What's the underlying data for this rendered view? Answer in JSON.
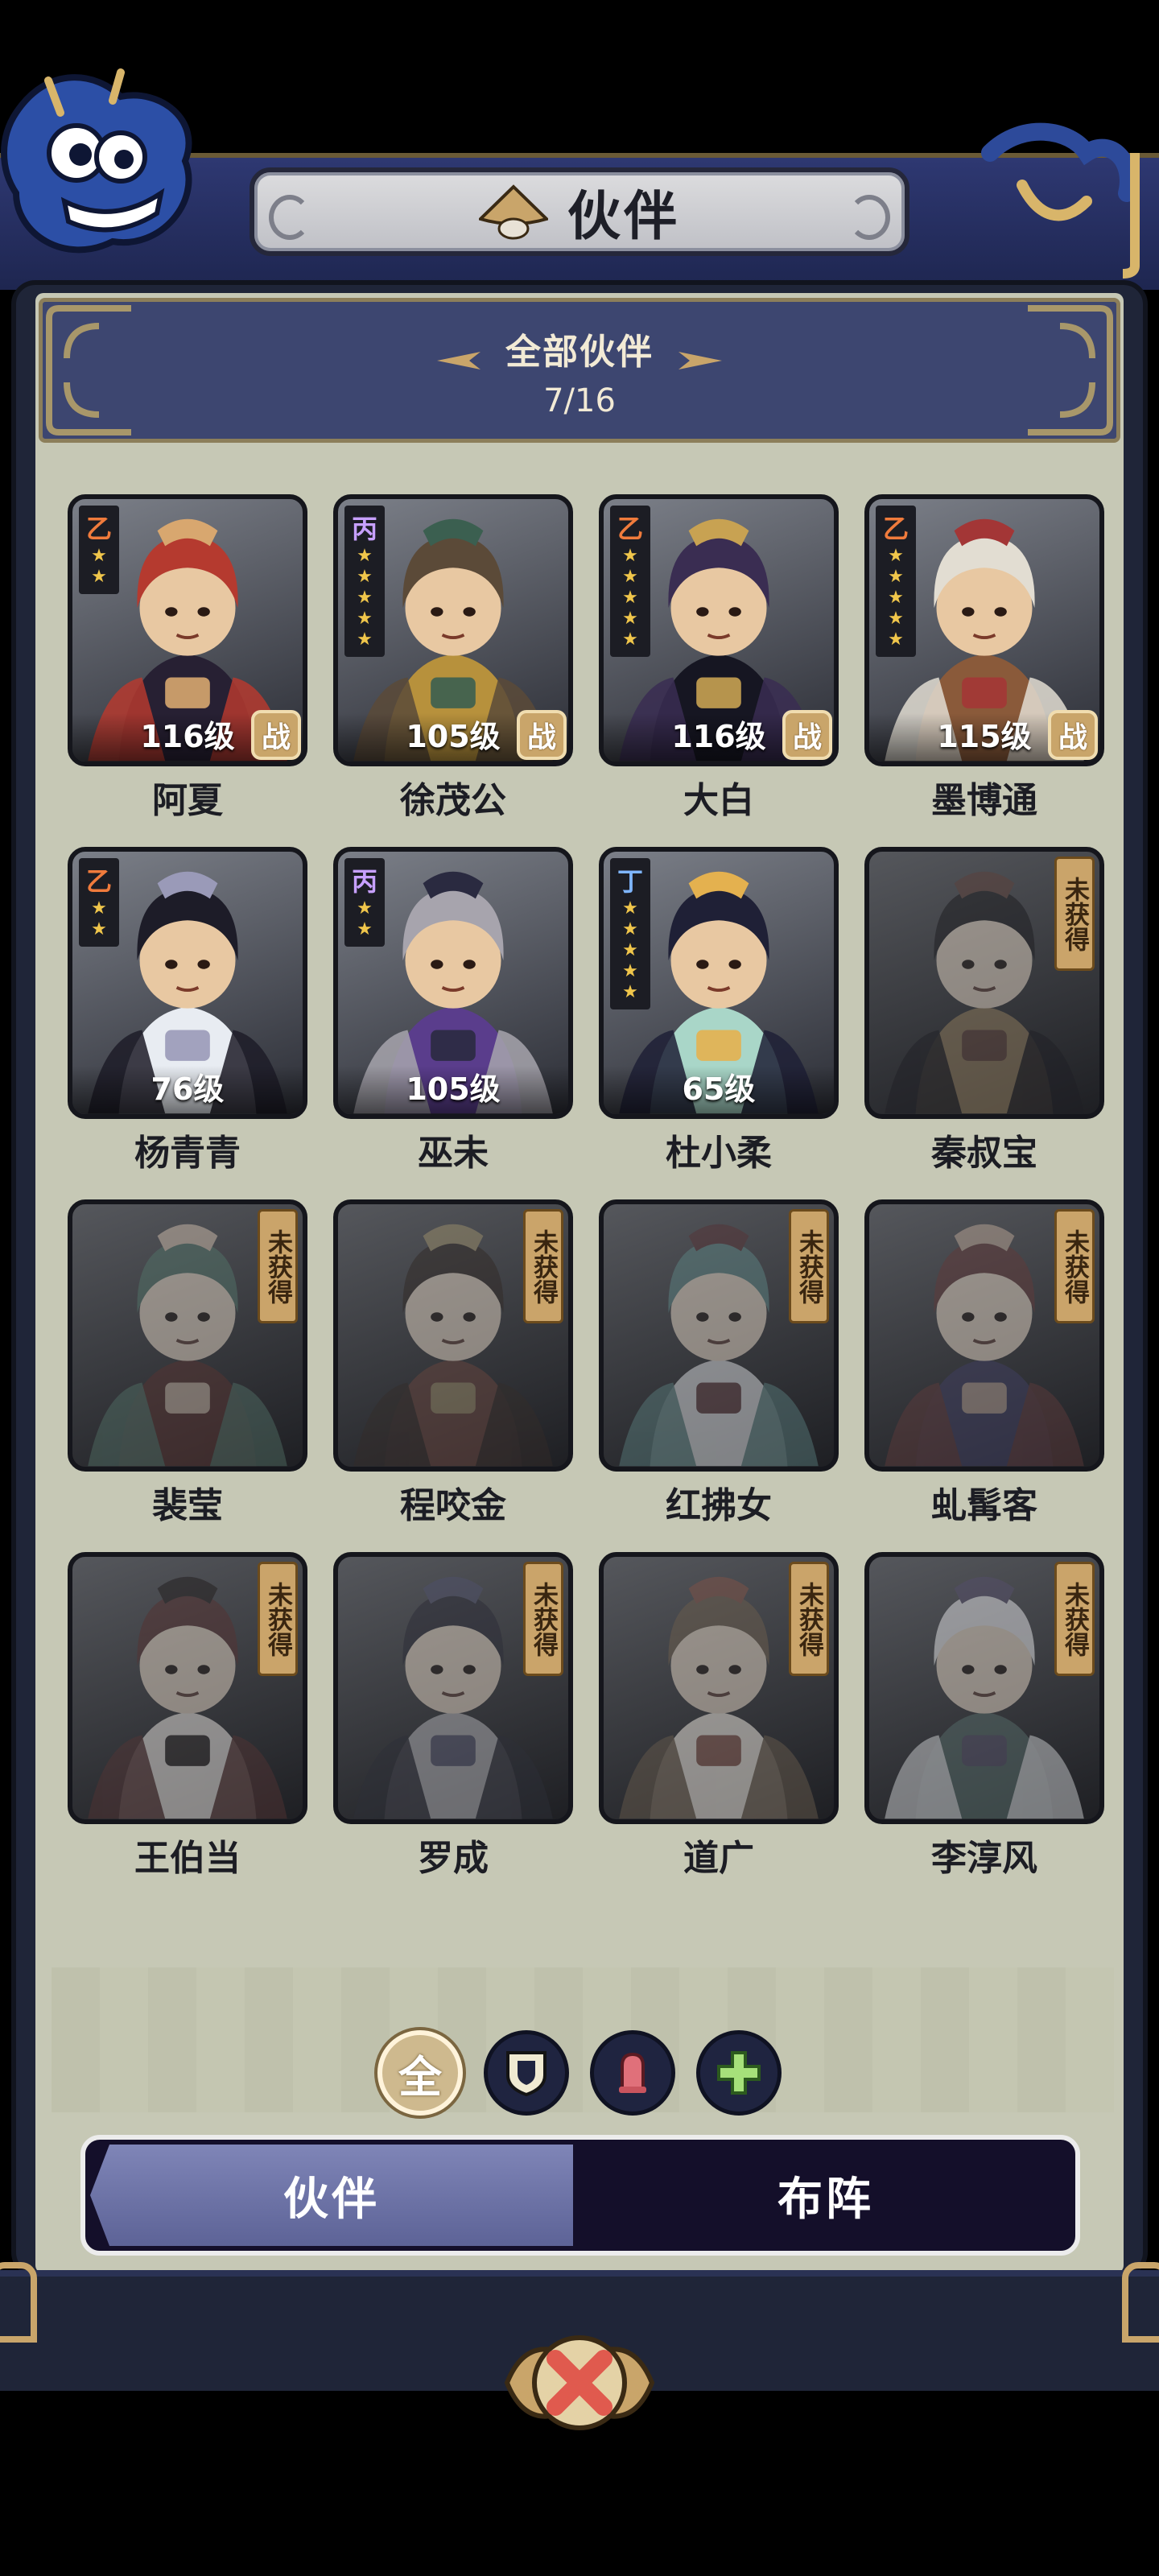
{
  "header": {
    "title": "伙伴"
  },
  "summary": {
    "title": "全部伙伴",
    "count": "7/16"
  },
  "partners": [
    {
      "name": "阿夏",
      "rank": "乙",
      "rank_color": "#f07b3c",
      "stars": 2,
      "level": "116级",
      "battle": "战",
      "locked": false,
      "palette": [
        "#b53a2f",
        "#272033",
        "#d8a76f"
      ]
    },
    {
      "name": "徐茂公",
      "rank": "丙",
      "rank_color": "#c7a0ff",
      "stars": 5,
      "level": "105级",
      "battle": "战",
      "locked": false,
      "palette": [
        "#5b4a38",
        "#b7913c",
        "#3b5f50"
      ]
    },
    {
      "name": "大白",
      "rank": "乙",
      "rank_color": "#f07b3c",
      "stars": 5,
      "level": "116级",
      "battle": "战",
      "locked": false,
      "palette": [
        "#3a2d52",
        "#161622",
        "#c8a252"
      ]
    },
    {
      "name": "墨博通",
      "rank": "乙",
      "rank_color": "#f07b3c",
      "stars": 5,
      "level": "115级",
      "battle": "战",
      "locked": false,
      "palette": [
        "#e2ddd2",
        "#8a5a3a",
        "#a33636"
      ]
    },
    {
      "name": "杨青青",
      "rank": "乙",
      "rank_color": "#f07b3c",
      "stars": 2,
      "level": "76级",
      "battle": "",
      "locked": false,
      "palette": [
        "#1d1c28",
        "#e8ecf2",
        "#9a9ab8"
      ]
    },
    {
      "name": "巫未",
      "rank": "丙",
      "rank_color": "#c7a0ff",
      "stars": 2,
      "level": "105级",
      "battle": "",
      "locked": false,
      "palette": [
        "#a7a4ad",
        "#5a3d8c",
        "#2a2a40"
      ]
    },
    {
      "name": "杜小柔",
      "rank": "丁",
      "rank_color": "#7fb6ff",
      "stars": 5,
      "level": "65级",
      "battle": "",
      "locked": false,
      "palette": [
        "#1f2036",
        "#a9d6c8",
        "#e4b14f"
      ]
    },
    {
      "name": "秦叔宝",
      "rank": "",
      "rank_color": "",
      "stars": 0,
      "level": "",
      "battle": "",
      "locked": true,
      "locked_text": "未获得",
      "palette": [
        "#20202a",
        "#a2742e",
        "#7a3a2c"
      ]
    },
    {
      "name": "裴莹",
      "rank": "",
      "rank_color": "",
      "stars": 0,
      "level": "",
      "battle": "",
      "locked": true,
      "locked_text": "未获得",
      "palette": [
        "#2f7a63",
        "#7b2a24",
        "#d7b08a"
      ]
    },
    {
      "name": "程咬金",
      "rank": "",
      "rank_color": "",
      "stars": 0,
      "level": "",
      "battle": "",
      "locked": true,
      "locked_text": "未获得",
      "palette": [
        "#3c2a22",
        "#8a3b2a",
        "#a88a3a"
      ]
    },
    {
      "name": "红拂女",
      "rank": "",
      "rank_color": "",
      "stars": 0,
      "level": "",
      "battle": "",
      "locked": true,
      "locked_text": "未获得",
      "palette": [
        "#2f8a8a",
        "#c9d0d6",
        "#7a2c34"
      ]
    },
    {
      "name": "虬髯客",
      "rank": "",
      "rank_color": "",
      "stars": 0,
      "level": "",
      "battle": "",
      "locked": true,
      "locked_text": "未获得",
      "palette": [
        "#8a2f2f",
        "#3d3a8a",
        "#c99a76"
      ]
    },
    {
      "name": "王伯当",
      "rank": "",
      "rank_color": "",
      "stars": 0,
      "level": "",
      "battle": "",
      "locked": true,
      "locked_text": "未获得",
      "palette": [
        "#7a2a2a",
        "#e0d6cc",
        "#2a2020"
      ]
    },
    {
      "name": "罗成",
      "rank": "",
      "rank_color": "",
      "stars": 0,
      "level": "",
      "battle": "",
      "locked": true,
      "locked_text": "未获得",
      "palette": [
        "#2c2e48",
        "#a8a8b2",
        "#4b4f8a"
      ]
    },
    {
      "name": "道广",
      "rank": "",
      "rank_color": "",
      "stars": 0,
      "level": "",
      "battle": "",
      "locked": true,
      "locked_text": "未获得",
      "palette": [
        "#7a5a34",
        "#e8ddc8",
        "#b0452c"
      ]
    },
    {
      "name": "李淳风",
      "rank": "",
      "rank_color": "",
      "stars": 0,
      "level": "",
      "battle": "",
      "locked": true,
      "locked_text": "未获得",
      "palette": [
        "#d6d8de",
        "#3c6d6a",
        "#5a4a8a"
      ]
    }
  ],
  "filters": [
    {
      "id": "all",
      "label": "全",
      "icon": "all-filter-icon",
      "active": true
    },
    {
      "id": "defense",
      "label": "",
      "icon": "shield-filter-icon",
      "active": false
    },
    {
      "id": "attack",
      "label": "",
      "icon": "bell-attack-filter-icon",
      "active": false
    },
    {
      "id": "heal",
      "label": "",
      "icon": "plus-heal-filter-icon",
      "active": false
    }
  ],
  "tabs": {
    "partners": "伙伴",
    "formation": "布阵",
    "active": "partners"
  },
  "colors": {
    "accent_gold": "#c9a56a",
    "panel_bg": "#c6c8b5",
    "banner_blue": "#3d4670",
    "close_red": "#e05a4e"
  }
}
